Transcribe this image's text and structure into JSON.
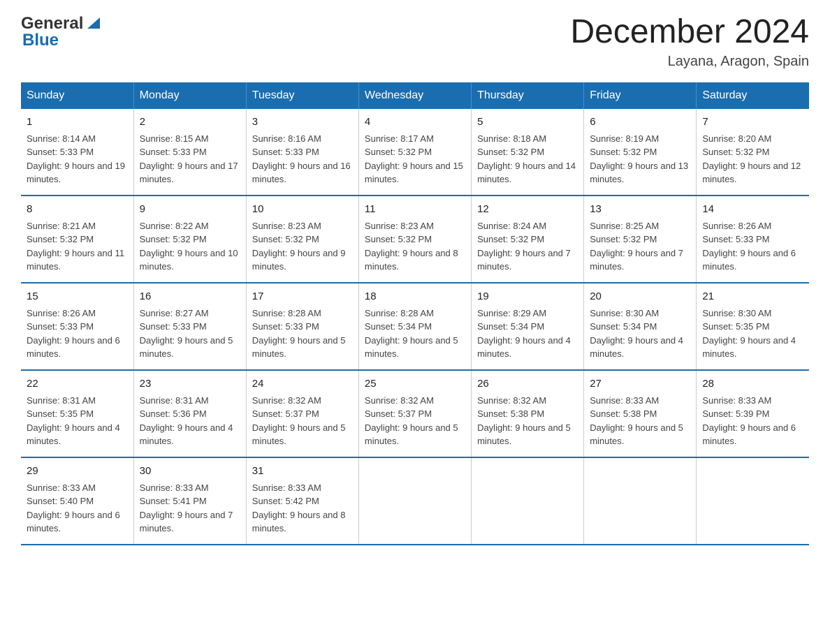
{
  "header": {
    "logo_general": "General",
    "logo_blue": "Blue",
    "title": "December 2024",
    "location": "Layana, Aragon, Spain"
  },
  "weekdays": [
    "Sunday",
    "Monday",
    "Tuesday",
    "Wednesday",
    "Thursday",
    "Friday",
    "Saturday"
  ],
  "weeks": [
    [
      {
        "day": "1",
        "sunrise": "8:14 AM",
        "sunset": "5:33 PM",
        "daylight": "9 hours and 19 minutes."
      },
      {
        "day": "2",
        "sunrise": "8:15 AM",
        "sunset": "5:33 PM",
        "daylight": "9 hours and 17 minutes."
      },
      {
        "day": "3",
        "sunrise": "8:16 AM",
        "sunset": "5:33 PM",
        "daylight": "9 hours and 16 minutes."
      },
      {
        "day": "4",
        "sunrise": "8:17 AM",
        "sunset": "5:32 PM",
        "daylight": "9 hours and 15 minutes."
      },
      {
        "day": "5",
        "sunrise": "8:18 AM",
        "sunset": "5:32 PM",
        "daylight": "9 hours and 14 minutes."
      },
      {
        "day": "6",
        "sunrise": "8:19 AM",
        "sunset": "5:32 PM",
        "daylight": "9 hours and 13 minutes."
      },
      {
        "day": "7",
        "sunrise": "8:20 AM",
        "sunset": "5:32 PM",
        "daylight": "9 hours and 12 minutes."
      }
    ],
    [
      {
        "day": "8",
        "sunrise": "8:21 AM",
        "sunset": "5:32 PM",
        "daylight": "9 hours and 11 minutes."
      },
      {
        "day": "9",
        "sunrise": "8:22 AM",
        "sunset": "5:32 PM",
        "daylight": "9 hours and 10 minutes."
      },
      {
        "day": "10",
        "sunrise": "8:23 AM",
        "sunset": "5:32 PM",
        "daylight": "9 hours and 9 minutes."
      },
      {
        "day": "11",
        "sunrise": "8:23 AM",
        "sunset": "5:32 PM",
        "daylight": "9 hours and 8 minutes."
      },
      {
        "day": "12",
        "sunrise": "8:24 AM",
        "sunset": "5:32 PM",
        "daylight": "9 hours and 7 minutes."
      },
      {
        "day": "13",
        "sunrise": "8:25 AM",
        "sunset": "5:32 PM",
        "daylight": "9 hours and 7 minutes."
      },
      {
        "day": "14",
        "sunrise": "8:26 AM",
        "sunset": "5:33 PM",
        "daylight": "9 hours and 6 minutes."
      }
    ],
    [
      {
        "day": "15",
        "sunrise": "8:26 AM",
        "sunset": "5:33 PM",
        "daylight": "9 hours and 6 minutes."
      },
      {
        "day": "16",
        "sunrise": "8:27 AM",
        "sunset": "5:33 PM",
        "daylight": "9 hours and 5 minutes."
      },
      {
        "day": "17",
        "sunrise": "8:28 AM",
        "sunset": "5:33 PM",
        "daylight": "9 hours and 5 minutes."
      },
      {
        "day": "18",
        "sunrise": "8:28 AM",
        "sunset": "5:34 PM",
        "daylight": "9 hours and 5 minutes."
      },
      {
        "day": "19",
        "sunrise": "8:29 AM",
        "sunset": "5:34 PM",
        "daylight": "9 hours and 4 minutes."
      },
      {
        "day": "20",
        "sunrise": "8:30 AM",
        "sunset": "5:34 PM",
        "daylight": "9 hours and 4 minutes."
      },
      {
        "day": "21",
        "sunrise": "8:30 AM",
        "sunset": "5:35 PM",
        "daylight": "9 hours and 4 minutes."
      }
    ],
    [
      {
        "day": "22",
        "sunrise": "8:31 AM",
        "sunset": "5:35 PM",
        "daylight": "9 hours and 4 minutes."
      },
      {
        "day": "23",
        "sunrise": "8:31 AM",
        "sunset": "5:36 PM",
        "daylight": "9 hours and 4 minutes."
      },
      {
        "day": "24",
        "sunrise": "8:32 AM",
        "sunset": "5:37 PM",
        "daylight": "9 hours and 5 minutes."
      },
      {
        "day": "25",
        "sunrise": "8:32 AM",
        "sunset": "5:37 PM",
        "daylight": "9 hours and 5 minutes."
      },
      {
        "day": "26",
        "sunrise": "8:32 AM",
        "sunset": "5:38 PM",
        "daylight": "9 hours and 5 minutes."
      },
      {
        "day": "27",
        "sunrise": "8:33 AM",
        "sunset": "5:38 PM",
        "daylight": "9 hours and 5 minutes."
      },
      {
        "day": "28",
        "sunrise": "8:33 AM",
        "sunset": "5:39 PM",
        "daylight": "9 hours and 6 minutes."
      }
    ],
    [
      {
        "day": "29",
        "sunrise": "8:33 AM",
        "sunset": "5:40 PM",
        "daylight": "9 hours and 6 minutes."
      },
      {
        "day": "30",
        "sunrise": "8:33 AM",
        "sunset": "5:41 PM",
        "daylight": "9 hours and 7 minutes."
      },
      {
        "day": "31",
        "sunrise": "8:33 AM",
        "sunset": "5:42 PM",
        "daylight": "9 hours and 8 minutes."
      },
      null,
      null,
      null,
      null
    ]
  ]
}
